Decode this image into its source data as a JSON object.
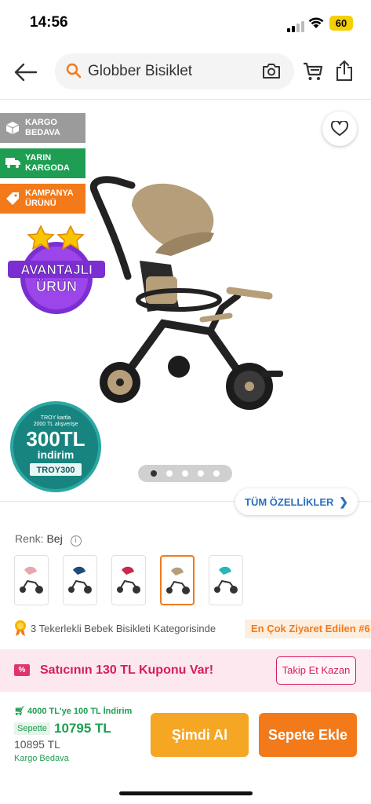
{
  "status_bar": {
    "time": "14:56",
    "battery": "60"
  },
  "search": {
    "query": "Globber Bisiklet"
  },
  "badges": [
    {
      "line1": "KARGO",
      "line2": "BEDAVA"
    },
    {
      "line1": "YARIN",
      "line2": "KARGODA"
    },
    {
      "line1": "KAMPANYA",
      "line2": "ÜRÜNÜ"
    }
  ],
  "promo_badge": {
    "line1": "AVANTAJLI",
    "line2": "ÜRÜN"
  },
  "troy_badge": {
    "line1": "TROY kartla",
    "line2": "2000 TL alışverişe",
    "amount": "300TL",
    "line3": "indirim",
    "code": "TROY300"
  },
  "gallery": {
    "image_count": 5,
    "active_index": 0
  },
  "specs_button": {
    "label": "TÜM ÖZELLİKLER"
  },
  "color": {
    "label": "Renk:",
    "value": "Bej",
    "selected_index": 3
  },
  "category": {
    "text": "3 Tekerlekli Bebek Bisikleti Kategorisinde",
    "rank": "En Çok Ziyaret Edilen #6"
  },
  "coupon": {
    "icon_text": "%",
    "text": "Satıcının 130 TL Kuponu Var!",
    "button": "Takip Et Kazan"
  },
  "pricing": {
    "promo": "4000 TL'ye 100 TL İndirim",
    "sepette_label": "Sepette",
    "sepette_price": "10795 TL",
    "price": "10895 TL",
    "shipping": "Kargo Bedava"
  },
  "actions": {
    "buy_now": "Şimdi Al",
    "add_to_cart": "Sepete Ekle"
  },
  "colors": {
    "accent": "#f27a1a",
    "green": "#1e9e52",
    "pink": "#d61d5c",
    "blue": "#2a6fbf"
  }
}
